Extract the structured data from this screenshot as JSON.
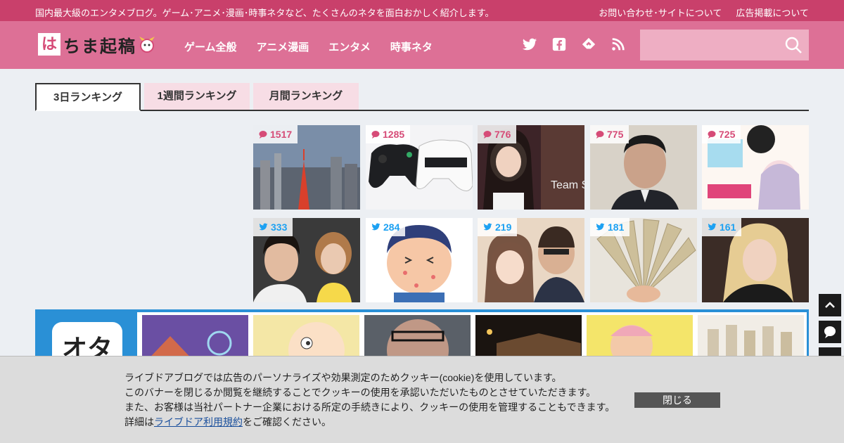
{
  "topbar": {
    "tagline": "国内最大級のエンタメブログ。ゲーム･アニメ･漫画･時事ネタなど、たくさんのネタを面白おかしく紹介します。",
    "links": [
      "お問い合わせ･サイトについて",
      "広告掲載について"
    ]
  },
  "header": {
    "logo_first": "は",
    "logo_rest": "ちま起稿",
    "nav": [
      "ゲーム全般",
      "アニメ漫画",
      "エンタメ",
      "時事ネタ"
    ],
    "social_icons": [
      "twitter-icon",
      "facebook-icon",
      "feedly-icon",
      "rss-icon"
    ],
    "search_placeholder": ""
  },
  "tabs": [
    "3日ランキング",
    "1週間ランキング",
    "月間ランキング"
  ],
  "ranking": {
    "comments": [
      {
        "count": "1517",
        "image": "tokyo-tower-cityscape"
      },
      {
        "count": "1285",
        "image": "game-controllers"
      },
      {
        "count": "776",
        "image": "idol-portrait"
      },
      {
        "count": "775",
        "image": "politician-portrait"
      },
      {
        "count": "725",
        "image": "manga-cover"
      }
    ],
    "tweets": [
      {
        "count": "333",
        "image": "celebrity-couple"
      },
      {
        "count": "284",
        "image": "itchy-boy-illustration"
      },
      {
        "count": "219",
        "image": "manga-couple-art"
      },
      {
        "count": "181",
        "image": "yen-bills-fan"
      },
      {
        "count": "161",
        "image": "blonde-artist"
      }
    ]
  },
  "ota": {
    "logo_text": "オタ"
  },
  "cookie": {
    "line1": "ライブドアブログでは広告のパーソナライズや効果測定のためクッキー(cookie)を使用しています。",
    "line2": "このバナーを閉じるか閲覧を継続することでクッキーの使用を承認いただいたものとさせていただきます。",
    "line3": "また、お客様は当社パートナー企業における所定の手続きにより、クッキーの使用を管理することもできます。",
    "line4_prefix": "詳細は",
    "line4_link": "ライブドア利用規約",
    "line4_suffix": "をご確認ください。",
    "close_label": "閉じる"
  },
  "colors": {
    "topbar": "#c9406b",
    "header": "#dd7096",
    "comment_accent": "#d64b77",
    "tweet_accent": "#1da1f2",
    "ota_blue": "#2a90d6"
  }
}
